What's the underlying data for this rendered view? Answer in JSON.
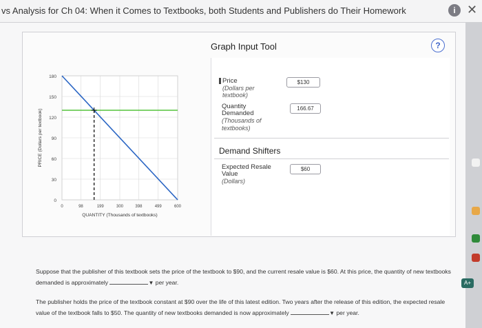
{
  "window": {
    "title": "vs Analysis for Ch 04: When it Comes to Textbooks, both Students and Publishers do Their Homework"
  },
  "tool": {
    "title": "Graph Input Tool",
    "help": "?"
  },
  "fields": {
    "price": {
      "label": "Price",
      "sub": "(Dollars per textbook)",
      "value": "$130"
    },
    "quantity": {
      "label": "Quantity Demanded",
      "sub": "(Thousands of textbooks)",
      "value": "166.67"
    },
    "shifters_title": "Demand Shifters",
    "resale": {
      "label": "Expected Resale Value",
      "sub": "(Dollars)",
      "value": "$60"
    }
  },
  "chart_data": {
    "type": "line",
    "xlabel": "QUANTITY (Thousands of textbooks)",
    "ylabel": "PRICE (Dollars per textbook)",
    "xlim": [
      0,
      600
    ],
    "ylim": [
      0,
      180
    ],
    "x_ticks": [
      "0",
      "98",
      "199",
      "300",
      "398",
      "499",
      "600"
    ],
    "y_ticks": [
      "0",
      "30",
      "60",
      "90",
      "120",
      "150",
      "180"
    ],
    "series": [
      {
        "color": "#2b66c4",
        "points": [
          [
            0,
            180
          ],
          [
            600,
            0
          ]
        ]
      },
      {
        "color": "#54c33a",
        "points": [
          [
            0,
            130
          ],
          [
            600,
            130
          ]
        ]
      }
    ],
    "dashed_vline": {
      "x": 166.67,
      "color": "#000000"
    },
    "marker": {
      "x": 166.67,
      "y": 130
    }
  },
  "questions": {
    "q1_text": "Suppose that the publisher of this textbook sets the price of the textbook to $90, and the current resale value is $60. At this price, the quantity of new textbooks demanded is approximately",
    "q1_unit": "per year.",
    "q2_text": "The publisher holds the price of the textbook constant at $90 over the life of this latest edition. Two years after the release of this edition, the expected resale value of the textbook falls to $50. The quantity of new textbooks demanded is now approximately",
    "q2_unit": "per year."
  },
  "icons": {
    "info": "info-icon",
    "close": "close-icon",
    "help": "help-icon",
    "dropdown": "caret-down-icon"
  }
}
